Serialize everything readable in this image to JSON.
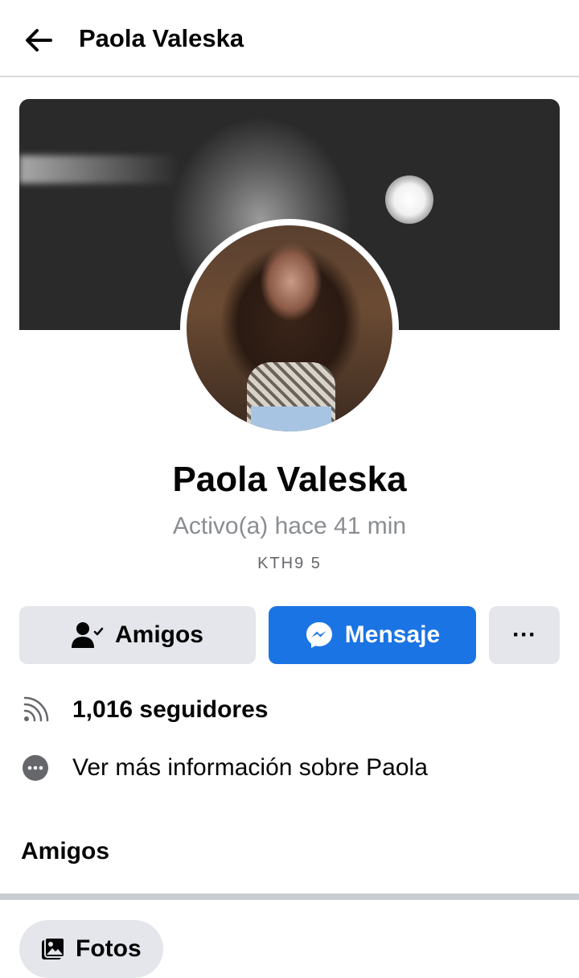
{
  "header": {
    "title": "Paola Valeska",
    "back_icon": "arrow-left-icon"
  },
  "profile": {
    "name": "Paola Valeska",
    "status": "Activo(a) hace 41 min",
    "bio": "KTH9 5"
  },
  "actions": {
    "friends_label": "Amigos",
    "message_label": "Mensaje",
    "more_label": "···"
  },
  "details": {
    "followers": "1,016 seguidores",
    "more_info": "Ver más información sobre Paola"
  },
  "sections": {
    "friends_title": "Amigos",
    "photos_chip": "Fotos"
  },
  "colors": {
    "accent": "#1b74e4",
    "button_gray": "#e4e6eb",
    "muted_text": "#8a8d91"
  }
}
